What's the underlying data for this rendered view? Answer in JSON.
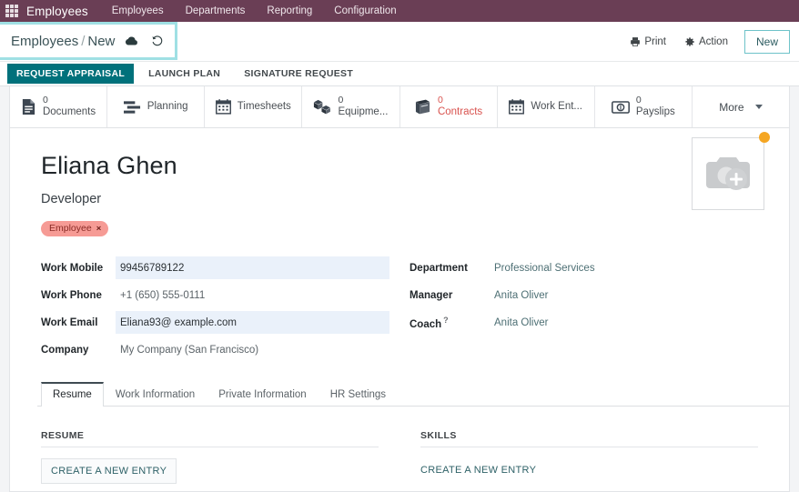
{
  "navbar": {
    "apps_icon": "apps-grid-icon",
    "brand": "Employees",
    "menu": [
      {
        "label": "Employees"
      },
      {
        "label": "Departments"
      },
      {
        "label": "Reporting"
      },
      {
        "label": "Configuration"
      }
    ]
  },
  "control_panel": {
    "breadcrumb_root": "Employees",
    "breadcrumb_sep": "/",
    "breadcrumb_current": "New",
    "save_icon": "cloud-save-icon",
    "discard_icon": "undo-discard-icon",
    "print_label": "Print",
    "print_icon": "printer-icon",
    "action_label": "Action",
    "action_icon": "gear-icon",
    "new_label": "New"
  },
  "status_buttons": {
    "primary": "REQUEST APPRAISAL",
    "secondary": [
      "LAUNCH PLAN",
      "SIGNATURE REQUEST"
    ]
  },
  "smart_buttons": [
    {
      "icon": "document-icon",
      "value": "0",
      "label": "Documents",
      "danger": false
    },
    {
      "icon": "planning-list-icon",
      "value": "",
      "label": "Planning",
      "danger": false
    },
    {
      "icon": "calendar-icon",
      "value": "",
      "label": "Timesheets",
      "danger": false
    },
    {
      "icon": "equipment-boxes-icon",
      "value": "0",
      "label": "Equipme...",
      "danger": false
    },
    {
      "icon": "contract-book-icon",
      "value": "0",
      "label": "Contracts",
      "danger": true
    },
    {
      "icon": "calendar-icon",
      "value": "",
      "label": "Work Ent...",
      "danger": false
    },
    {
      "icon": "payslip-money-icon",
      "value": "0",
      "label": "Payslips",
      "danger": false
    }
  ],
  "more_button": {
    "label": "More",
    "icon": "chevron-down-icon"
  },
  "record": {
    "name": "Eliana Ghen",
    "job_title": "Developer",
    "tag": {
      "label": "Employee",
      "remove_icon": "×"
    },
    "avatar": {
      "icon": "camera-add-icon",
      "badge": "unsaved-dot"
    }
  },
  "fields_left": [
    {
      "label": "Work Mobile",
      "value": "99456789122",
      "highlight": true
    },
    {
      "label": "Work Phone",
      "value": "+1 (650) 555-0111",
      "highlight": false
    },
    {
      "label": "Work Email",
      "value": "Eliana93@ example.com",
      "highlight": true
    },
    {
      "label": "Company",
      "value": "My Company (San Francisco)",
      "highlight": false
    }
  ],
  "fields_right": [
    {
      "label": "Department",
      "value": "Professional Services",
      "help": false
    },
    {
      "label": "Manager",
      "value": "Anita Oliver",
      "help": false
    },
    {
      "label": "Coach",
      "value": "Anita Oliver",
      "help": true,
      "help_glyph": "?"
    }
  ],
  "tabs": [
    {
      "label": "Resume",
      "active": true
    },
    {
      "label": "Work Information",
      "active": false
    },
    {
      "label": "Private Information",
      "active": false
    },
    {
      "label": "HR Settings",
      "active": false
    }
  ],
  "panes": {
    "resume": {
      "title": "RESUME",
      "action": "CREATE A NEW ENTRY"
    },
    "skills": {
      "title": "SKILLS",
      "action": "CREATE A NEW ENTRY"
    }
  },
  "colors": {
    "navbar": "#6a3e55",
    "primary_teal": "#00717b",
    "highlight_box": "#9fe0e4",
    "field_highlight": "#eaf1fa",
    "tag_bg": "#f69b95",
    "danger": "#d9534f",
    "dot": "#f5a623"
  }
}
